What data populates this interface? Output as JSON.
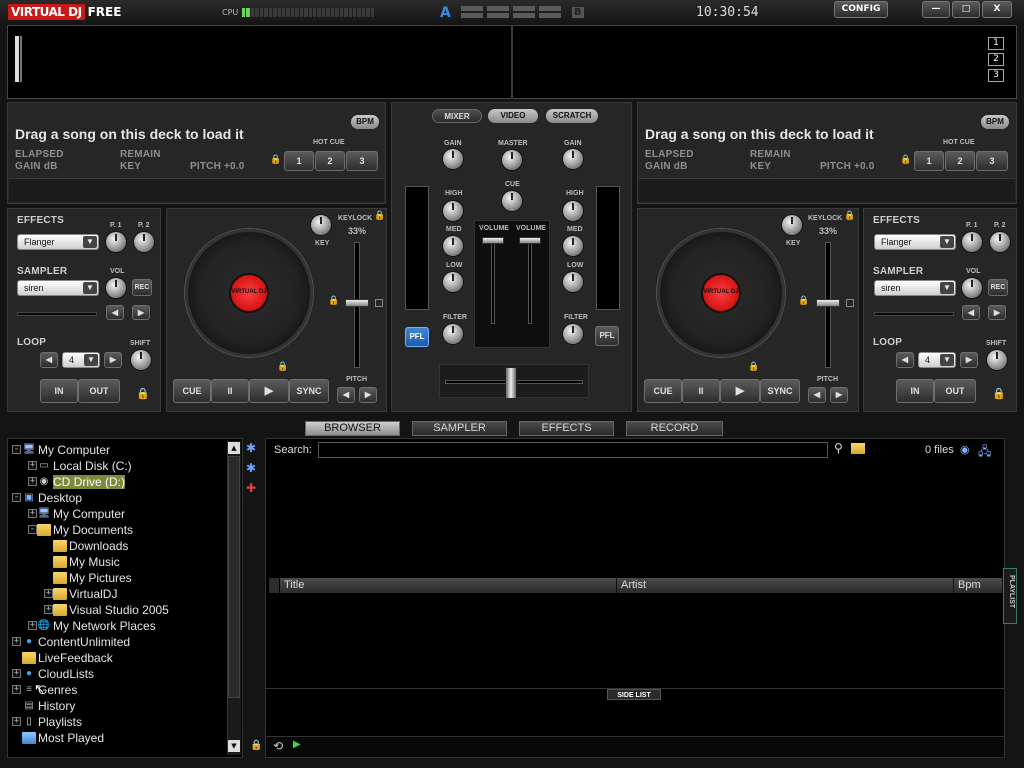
{
  "app": {
    "logo_main": "VIRTUAL DJ",
    "logo_suffix": "FREE",
    "cpu_label": "CPU",
    "crossfader_a": "A",
    "crossfader_b": "B",
    "clock": "10:30:54",
    "config_label": "CONFIG",
    "minimize": "—",
    "maximize": "□",
    "close": "X"
  },
  "waveform": {
    "zoom": [
      "1",
      "2",
      "3"
    ]
  },
  "deck_left": {
    "message": "Drag a song on this deck to load it",
    "bpm": "BPM",
    "elapsed": "ELAPSED",
    "remain": "REMAIN",
    "gain_db": "GAIN dB",
    "key": "KEY",
    "pitch_readout": "PITCH +0.0",
    "hot_cue": "HOT CUE",
    "hot_cue_buttons": [
      "1",
      "2",
      "3"
    ],
    "effects": "EFFECTS",
    "effect_value": "Flanger",
    "p1": "P. 1",
    "p2": "P. 2",
    "sampler": "SAMPLER",
    "sampler_value": "siren",
    "vol": "VOL",
    "rec": "REC",
    "loop": "LOOP",
    "loop_value": "4",
    "shift": "SHIFT",
    "in": "IN",
    "out": "OUT",
    "keylock": "KEYLOCK",
    "keylock_pct": "33%",
    "key_knob": "KEY",
    "pitch": "PITCH",
    "cue": "CUE",
    "pause": "II",
    "play": "▶",
    "sync": "SYNC",
    "platter_label": "VIRTUAL DJ"
  },
  "deck_right": {
    "message": "Drag a song on this deck to load it",
    "bpm": "BPM",
    "elapsed": "ELAPSED",
    "remain": "REMAIN",
    "gain_db": "GAIN dB",
    "key": "KEY",
    "pitch_readout": "PITCH +0.0",
    "hot_cue": "HOT CUE",
    "hot_cue_buttons": [
      "1",
      "2",
      "3"
    ],
    "effects": "EFFECTS",
    "effect_value": "Flanger",
    "p1": "P. 1",
    "p2": "P. 2",
    "sampler": "SAMPLER",
    "sampler_value": "siren",
    "vol": "VOL",
    "rec": "REC",
    "loop": "LOOP",
    "loop_value": "4",
    "shift": "SHIFT",
    "in": "IN",
    "out": "OUT",
    "keylock": "KEYLOCK",
    "keylock_pct": "33%",
    "key_knob": "KEY",
    "pitch": "PITCH",
    "cue": "CUE",
    "pause": "II",
    "play": "▶",
    "sync": "SYNC",
    "platter_label": "VIRTUAL DJ"
  },
  "mixer": {
    "tabs": [
      "MIXER",
      "VIDEO",
      "SCRATCH"
    ],
    "gain": "GAIN",
    "master": "MASTER",
    "cue": "CUE",
    "high": "HIGH",
    "med": "MED",
    "low": "LOW",
    "volume": "VOLUME",
    "filter": "FILTER",
    "pfl": "PFL"
  },
  "browser_tabs": [
    "BROWSER",
    "SAMPLER",
    "EFFECTS",
    "RECORD"
  ],
  "tree": [
    {
      "label": "My Computer",
      "icon": "computer-icon",
      "exp": "-"
    },
    {
      "label": "Local Disk (C:)",
      "icon": "drive-icon",
      "exp": "+"
    },
    {
      "label": "CD Drive (D:)",
      "icon": "cd-icon",
      "exp": "+",
      "selected": true
    },
    {
      "label": "Desktop",
      "icon": "desktop-icon",
      "exp": "-"
    },
    {
      "label": "My Computer",
      "icon": "computer-icon",
      "exp": "+"
    },
    {
      "label": "My Documents",
      "icon": "documents-icon",
      "exp": "-"
    },
    {
      "label": "Downloads",
      "icon": "folder-icon",
      "exp": ""
    },
    {
      "label": "My Music",
      "icon": "music-folder-icon",
      "exp": ""
    },
    {
      "label": "My Pictures",
      "icon": "pictures-folder-icon",
      "exp": ""
    },
    {
      "label": "VirtualDJ",
      "icon": "folder-icon",
      "exp": "+"
    },
    {
      "label": "Visual Studio 2005",
      "icon": "folder-icon",
      "exp": "+"
    },
    {
      "label": "My Network Places",
      "icon": "network-icon",
      "exp": "+"
    },
    {
      "label": "ContentUnlimited",
      "icon": "globe-icon",
      "exp": "+"
    },
    {
      "label": "LiveFeedback",
      "icon": "folder-icon",
      "exp": ""
    },
    {
      "label": "CloudLists",
      "icon": "globe-icon",
      "exp": "+"
    },
    {
      "label": "Genres",
      "icon": "genres-icon",
      "exp": "+"
    },
    {
      "label": "History",
      "icon": "history-icon",
      "exp": ""
    },
    {
      "label": "Playlists",
      "icon": "playlist-icon",
      "exp": "+"
    },
    {
      "label": "Most Played",
      "icon": "most-played-icon",
      "exp": ""
    }
  ],
  "files": {
    "search_label": "Search:",
    "count": "0 files",
    "columns": [
      "Title",
      "Artist",
      "Bpm"
    ],
    "side_list": "SIDE LIST",
    "playlist_tab": "PLAYLIST"
  }
}
